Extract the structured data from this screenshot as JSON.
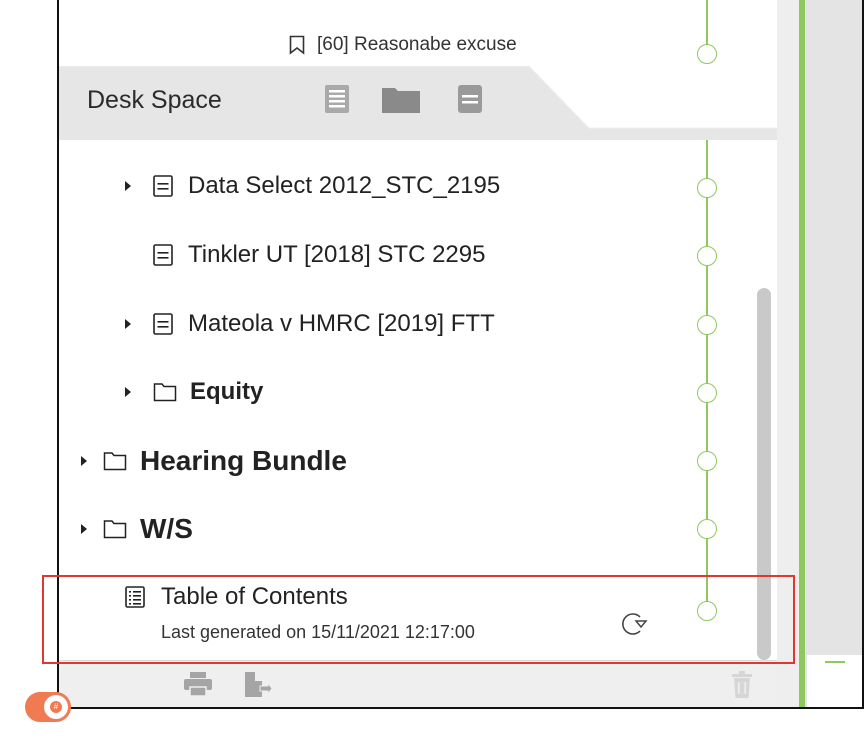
{
  "top_item": {
    "label": "[60] Reasonabe excuse",
    "icon": "bookmark-icon"
  },
  "tab": {
    "title": "Desk Space",
    "icons": [
      "table-of-contents-icon",
      "folder-icon",
      "document-icon"
    ]
  },
  "tree": [
    {
      "label": "Data Select 2012_STC_2195",
      "type": "document",
      "expandable": true,
      "bold": false
    },
    {
      "label": "Tinkler UT [2018] STC 2295",
      "type": "document",
      "expandable": false,
      "bold": false
    },
    {
      "label": "Mateola v HMRC [2019] FTT",
      "type": "document",
      "expandable": true,
      "bold": false
    },
    {
      "label": "Equity",
      "type": "folder",
      "expandable": true,
      "bold": true
    },
    {
      "label": "Hearing Bundle",
      "type": "folder",
      "expandable": true,
      "bold": true
    },
    {
      "label": "W/S",
      "type": "folder",
      "expandable": true,
      "bold": true
    }
  ],
  "toc": {
    "title": "Table of Contents",
    "subtitle": "Last generated on 15/11/2021 12:17:00",
    "regenerate_icon": "regenerate-icon"
  },
  "bottom_toolbar": {
    "icons": [
      "page-numbering-toggle",
      "print-icon",
      "export-icon",
      "trash-icon"
    ]
  },
  "colors": {
    "accent_green": "#8fc85e",
    "toggle_orange": "#f07a52",
    "highlight_red": "#e0382f"
  }
}
